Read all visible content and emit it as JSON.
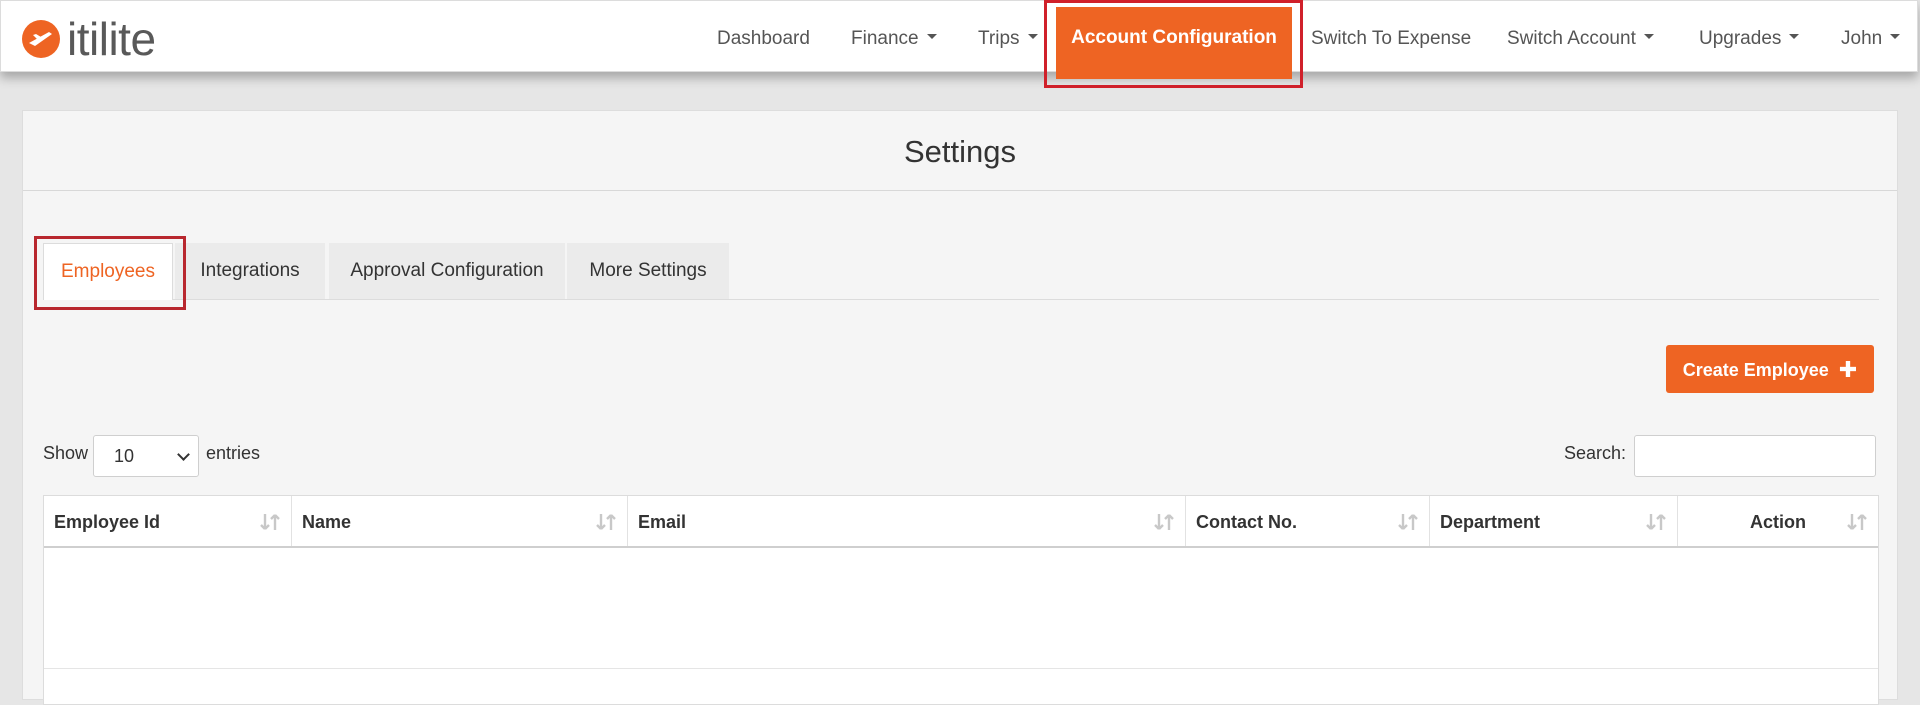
{
  "brand": {
    "name": "itilite"
  },
  "nav": {
    "items": [
      {
        "label": "Dashboard",
        "has_caret": false
      },
      {
        "label": "Finance",
        "has_caret": true
      },
      {
        "label": "Trips",
        "has_caret": true
      },
      {
        "label": "Account Configuration",
        "has_caret": false,
        "active": true
      },
      {
        "label": "Switch To Expense",
        "has_caret": false
      },
      {
        "label": "Switch Account",
        "has_caret": true
      },
      {
        "label": "Upgrades",
        "has_caret": true
      },
      {
        "label": "John",
        "has_caret": true
      }
    ]
  },
  "page": {
    "title": "Settings"
  },
  "tabs": [
    {
      "label": "Employees",
      "active": true
    },
    {
      "label": "Integrations",
      "active": false
    },
    {
      "label": "Approval Configuration",
      "active": false
    },
    {
      "label": "More Settings",
      "active": false
    }
  ],
  "actions": {
    "create_employee": "Create Employee",
    "create_icon": "plus-icon"
  },
  "table_controls": {
    "show_label": "Show",
    "entries_value": "10",
    "entries_label": "entries",
    "search_label": "Search:",
    "search_value": ""
  },
  "table": {
    "columns": [
      "Employee Id",
      "Name",
      "Email",
      "Contact No.",
      "Department",
      "Action"
    ],
    "rows": []
  },
  "colors": {
    "accent": "#ee6423",
    "highlight_box": "#d0202a"
  }
}
